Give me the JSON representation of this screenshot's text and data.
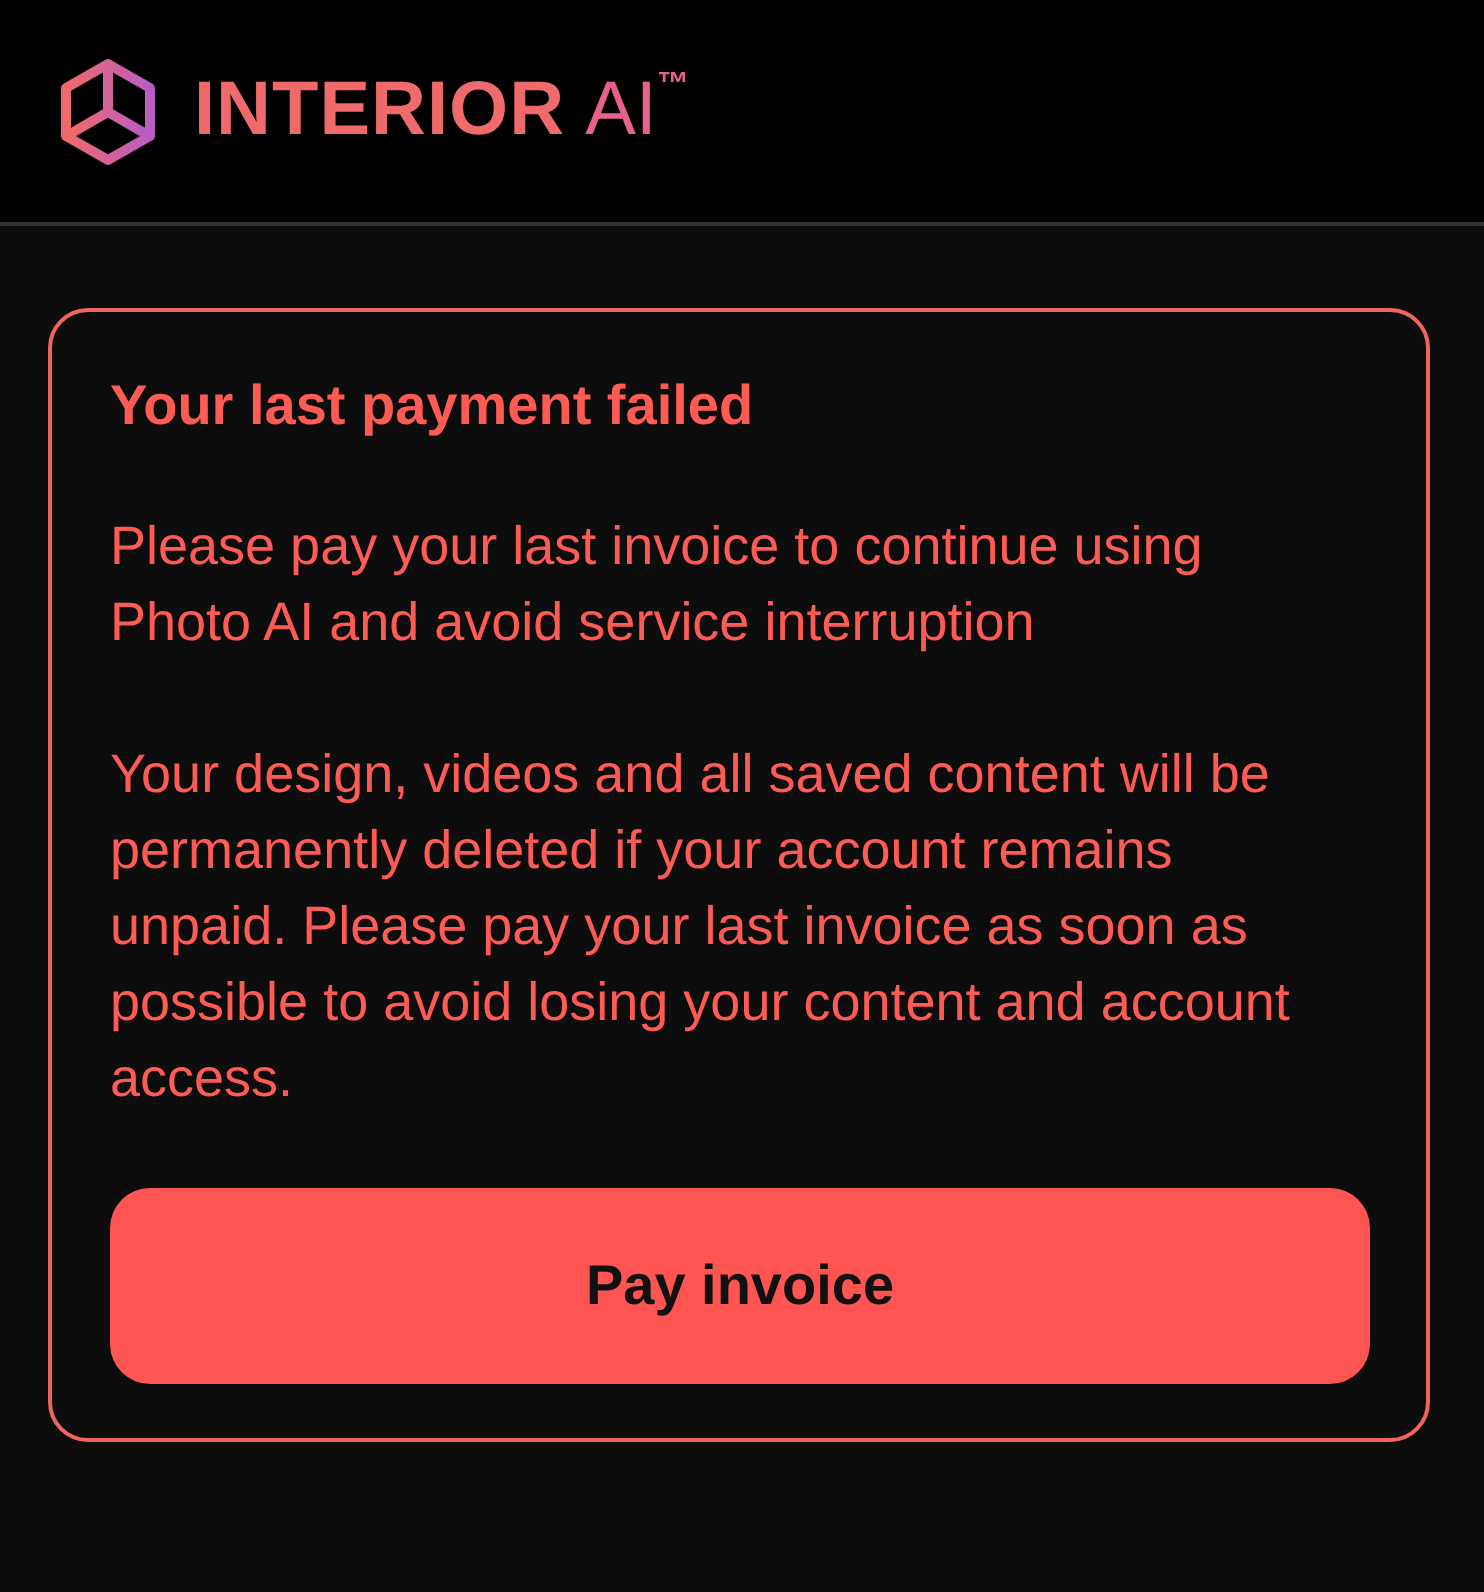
{
  "header": {
    "logo_word": "INTERIOR",
    "logo_suffix": "AI$^{™}$"
  },
  "alert": {
    "title": "Your last payment failed",
    "paragraphs": [
      "Please pay your last invoice to continue using Photo AI and avoid service interruption",
      "Your design, videos and all saved content will be permanently deleted if your account remains unpaid. Please pay your last invoice as soon as possible to avoid losing your content and account access."
    ],
    "button": "Pay invoice"
  }
}
